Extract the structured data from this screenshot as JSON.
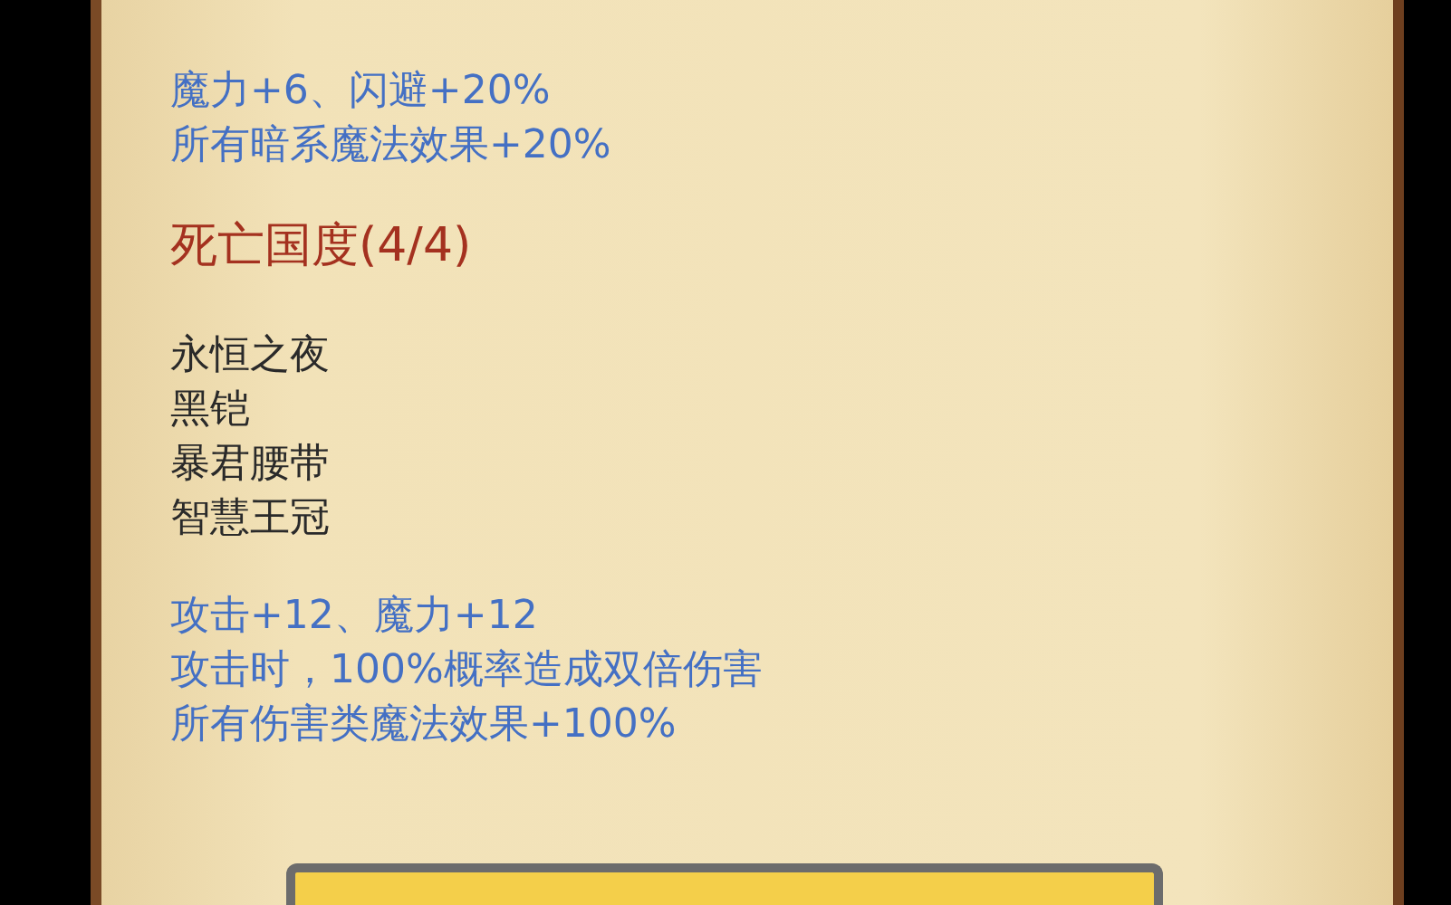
{
  "blocks": [
    {
      "kind": "bonus",
      "lines": [
        "魔力+6、闪避+20%",
        "所有暗系魔法效果+20%"
      ]
    },
    {
      "kind": "set_title",
      "text": "死亡国度(4/4)"
    },
    {
      "kind": "items",
      "lines": [
        "永恒之夜",
        "黑铠",
        "暴君腰带",
        "智慧王冠"
      ]
    },
    {
      "kind": "bonus",
      "lines": [
        "攻击+12、魔力+12",
        "攻击时，100%概率造成双倍伤害",
        "所有伤害类魔法效果+100%"
      ]
    }
  ]
}
